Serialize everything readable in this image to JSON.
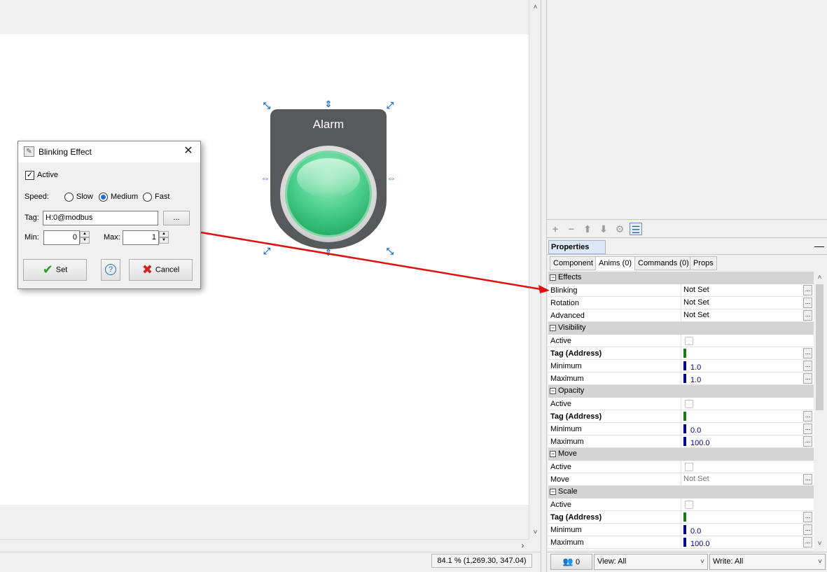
{
  "canvas": {
    "scroll_down": "˅",
    "scroll_up": "˄",
    "scroll_right": "›"
  },
  "status": {
    "zoom_coords": "84.1 %  (1,269.30, 347.04)"
  },
  "alarm_widget": {
    "label": "Alarm",
    "lamp_color": "#3cc97f"
  },
  "dialog": {
    "title": "Blinking Effect",
    "close": "✕",
    "active_label": "Active",
    "active_checked": "✓",
    "speed_label": "Speed:",
    "speed_options": [
      "Slow",
      "Medium",
      "Fast"
    ],
    "speed_selected": "Medium",
    "tag_label": "Tag:",
    "tag_value": "H:0@modbus",
    "browse": "...",
    "min_label": "Min:",
    "min_value": "0",
    "max_label": "Max:",
    "max_value": "1",
    "set_label": "Set",
    "help_label": "?",
    "cancel_label": "Cancel"
  },
  "toolbar": {
    "add": "+",
    "remove": "−",
    "move_up": "⬆",
    "move_down": "⬇",
    "settings": "⚙",
    "list": "☰"
  },
  "properties": {
    "title": "Properties",
    "minimize": "—",
    "tabs": [
      "Component",
      "Anims (0)",
      "Commands (0)",
      "Props"
    ],
    "active_tab": "Anims (0)",
    "effects": "Effects",
    "effects_rows": [
      {
        "name": "Blinking",
        "value": "Not Set"
      },
      {
        "name": "Rotation",
        "value": "Not Set"
      },
      {
        "name": "Advanced",
        "value": "Not Set"
      }
    ],
    "visibility": "Visibility",
    "visibility_rows": [
      {
        "name": "Active"
      },
      {
        "name": "Tag (Address)"
      },
      {
        "name": "Minimum",
        "value": "1.0"
      },
      {
        "name": "Maximum",
        "value": "1.0"
      }
    ],
    "opacity": "Opacity",
    "opacity_rows": [
      {
        "name": "Active"
      },
      {
        "name": "Tag (Address)"
      },
      {
        "name": "Minimum",
        "value": "0.0"
      },
      {
        "name": "Maximum",
        "value": "100.0"
      }
    ],
    "move": "Move",
    "move_rows": [
      {
        "name": "Active"
      },
      {
        "name": "Move",
        "value": "Not Set"
      }
    ],
    "scale": "Scale",
    "scale_rows": [
      {
        "name": "Active"
      },
      {
        "name": "Tag (Address)"
      },
      {
        "name": "Minimum",
        "value": "0.0"
      },
      {
        "name": "Maximum",
        "value": "100.0"
      }
    ],
    "dots": "...",
    "toggle": "−",
    "tag_bar_color": "#1a7a1a",
    "num_bar_color": "#00008b"
  },
  "bottom": {
    "users_count": "0",
    "view_label": "View: All",
    "write_label": "Write: All",
    "dropdown": "˅"
  },
  "colors": {
    "arrow": "#e01010",
    "handle": "#1b6fd1"
  }
}
